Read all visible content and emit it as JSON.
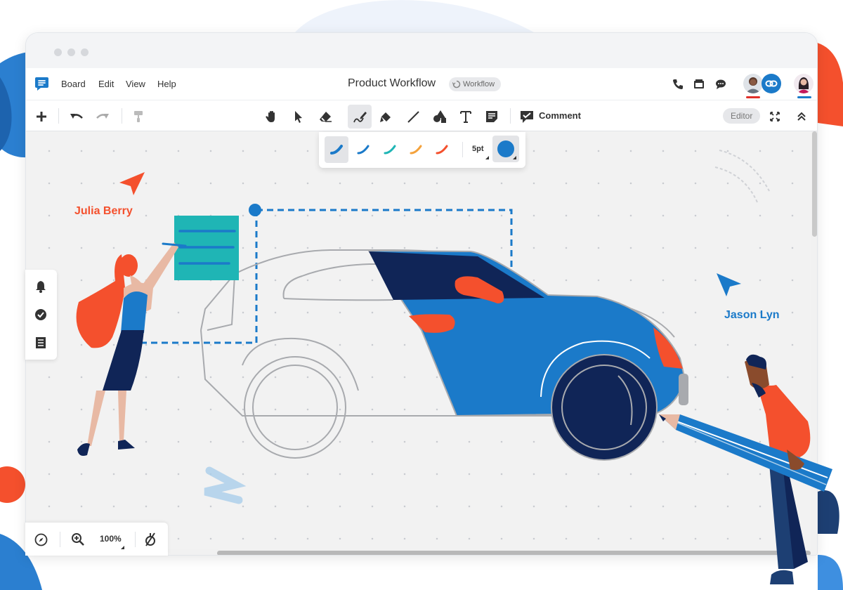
{
  "menu": {
    "items": [
      "Board",
      "Edit",
      "View",
      "Help"
    ]
  },
  "document": {
    "title": "Product Workflow",
    "workflow_badge": "Workflow"
  },
  "header_icons": [
    "phone-icon",
    "video-icon",
    "chat-icon",
    "link-icon"
  ],
  "toolbar": {
    "left_tools": [
      "add-icon",
      "undo-icon",
      "redo-icon",
      "format-painter-icon"
    ],
    "center_tools": [
      "hand-icon",
      "select-arrow-icon",
      "eraser-icon",
      "pen-icon",
      "highlighter-icon",
      "line-icon",
      "shapes-icon",
      "text-icon",
      "sticky-note-icon"
    ],
    "comment_label": "Comment",
    "mode_badge": "Editor",
    "right_tools": [
      "fullscreen-icon",
      "collapse-icon"
    ]
  },
  "pen_options": {
    "strokes": [
      {
        "color": "#1b7ac9",
        "active": true
      },
      {
        "color": "#1b7ac9",
        "active": false
      },
      {
        "color": "#1fb5b5",
        "active": false
      },
      {
        "color": "#f4a23c",
        "active": false
      },
      {
        "color": "#f4502d",
        "active": false
      }
    ],
    "size_label": "5pt",
    "selected_color": "#1b7ac9"
  },
  "collaborators": [
    {
      "name": "Julia Berry",
      "color": "#f4502d"
    },
    {
      "name": "Jason Lyn",
      "color": "#1b7ac9"
    }
  ],
  "left_panel_icons": [
    "bell-icon",
    "check-circle-icon",
    "list-icon"
  ],
  "zoom": {
    "level": "100%"
  },
  "colors": {
    "accent_blue": "#1b7ac9",
    "navy": "#102557",
    "orange": "#f4502d",
    "teal": "#1fb5b5",
    "canvas_bg": "#f2f2f2"
  }
}
